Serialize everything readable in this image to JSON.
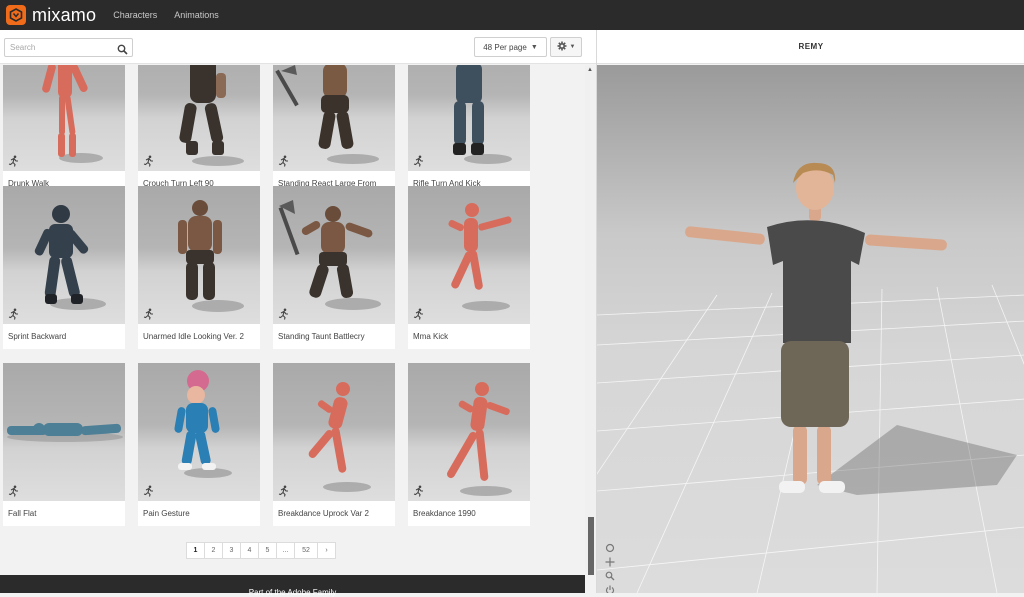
{
  "header": {
    "brand": "mixamo",
    "nav": [
      "Characters",
      "Animations"
    ]
  },
  "toolbar": {
    "search_placeholder": "Search",
    "per_page": "48 Per page"
  },
  "cards": [
    {
      "label": "Drunk Walk",
      "icon": "running-figure-icon"
    },
    {
      "label": "Crouch Turn Left 90",
      "icon": "running-figure-icon"
    },
    {
      "label": "Standing React Large From",
      "icon": "running-figure-icon"
    },
    {
      "label": "Rifle Turn And Kick",
      "icon": "running-figure-icon"
    },
    {
      "label": "Sprint Backward",
      "icon": "running-figure-icon"
    },
    {
      "label": "Unarmed Idle Looking Ver. 2",
      "icon": "running-figure-icon"
    },
    {
      "label": "Standing Taunt Battlecry",
      "icon": "running-figure-icon"
    },
    {
      "label": "Mma Kick",
      "icon": "running-figure-icon"
    },
    {
      "label": "Fall Flat",
      "icon": "running-figure-icon"
    },
    {
      "label": "Pain Gesture",
      "icon": "running-figure-icon"
    },
    {
      "label": "Breakdance Uprock Var 2",
      "icon": "running-figure-icon"
    },
    {
      "label": "Breakdance 1990",
      "icon": "running-figure-icon"
    }
  ],
  "pagination": {
    "pages": [
      "1",
      "2",
      "3",
      "4",
      "5",
      "...",
      "52",
      "›"
    ],
    "current": "1"
  },
  "footer": {
    "text": "Part of the Adobe Family"
  },
  "viewer": {
    "character_name": "REMY"
  },
  "colors": {
    "topbar": "#2b2b2b",
    "brand_orange": "#f06c1b",
    "mannequin": "#d86c5c"
  }
}
